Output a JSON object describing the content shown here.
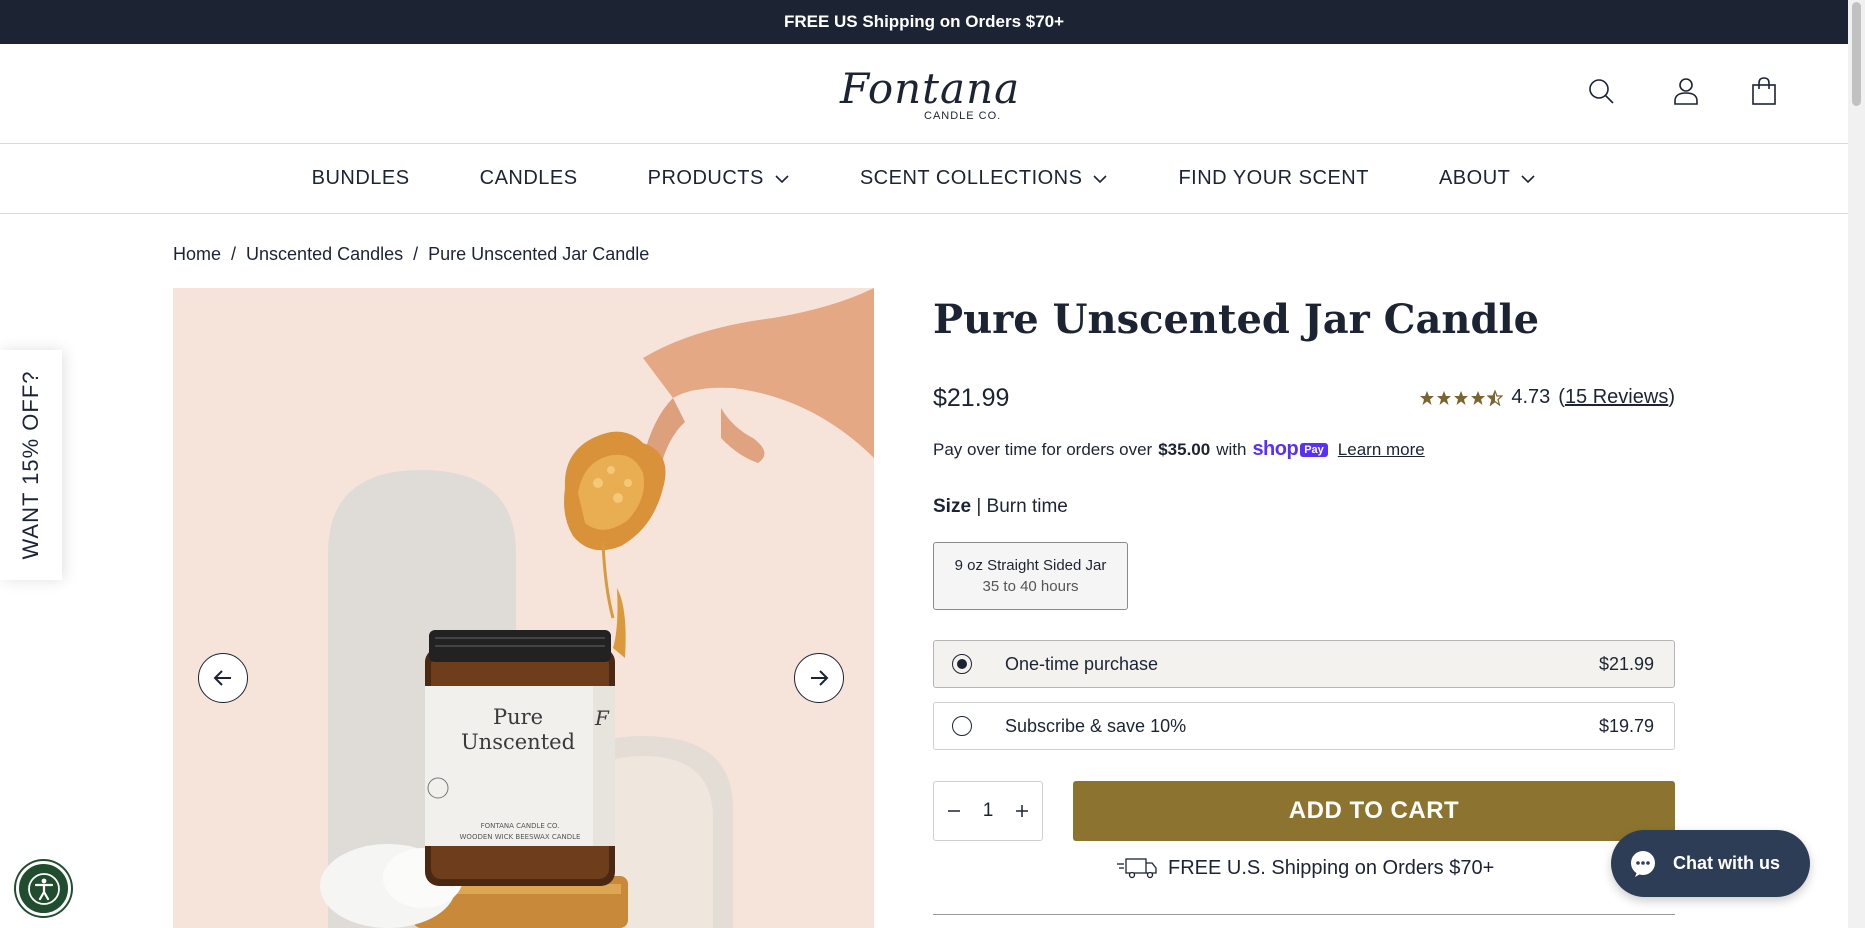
{
  "announcement": {
    "text": "FREE US Shipping on Orders $70+"
  },
  "header": {
    "logo": {
      "name": "Fontana",
      "tagline": "CANDLE CO."
    },
    "icons": [
      "search-icon",
      "account-icon",
      "cart-icon"
    ]
  },
  "nav": {
    "items": [
      {
        "label": "BUNDLES",
        "has_dropdown": false
      },
      {
        "label": "CANDLES",
        "has_dropdown": false
      },
      {
        "label": "PRODUCTS",
        "has_dropdown": true
      },
      {
        "label": "SCENT COLLECTIONS",
        "has_dropdown": true
      },
      {
        "label": "FIND YOUR SCENT",
        "has_dropdown": false
      },
      {
        "label": "ABOUT",
        "has_dropdown": true
      }
    ]
  },
  "breadcrumb": {
    "items": [
      "Home",
      "Unscented Candles",
      "Pure Unscented Jar Candle"
    ],
    "separator": "/"
  },
  "gallery": {
    "jar_label_line1": "Pure",
    "jar_label_line2": "Unscented",
    "jar_small_1": "FONTANA CANDLE CO.",
    "jar_small_2": "WOODEN WICK BEESWAX CANDLE",
    "jar_side_letter": "F"
  },
  "side_tab": {
    "label": "WANT 15% OFF?"
  },
  "product": {
    "title": "Pure Unscented Jar Candle",
    "price": "$21.99",
    "rating": {
      "stars": 4.5,
      "value": "4.73",
      "paren_open": "(",
      "reviews_label": "15 Reviews",
      "paren_close": ")"
    },
    "payover": {
      "prefix": "Pay over time for orders over",
      "amount": "$35.00",
      "suffix": "with",
      "shop": "shop",
      "pay": "Pay",
      "learn_more": "Learn more"
    },
    "size": {
      "label_bold": "Size",
      "label_rest": "| Burn time",
      "option_name": "9 oz Straight Sided Jar",
      "option_sub": "35 to 40 hours"
    },
    "plans": [
      {
        "label": "One-time purchase",
        "price": "$21.99",
        "selected": true
      },
      {
        "label": "Subscribe & save 10%",
        "price": "$19.79",
        "selected": false
      }
    ],
    "quantity": "1",
    "add_to_cart": "ADD TO CART",
    "shipping_note": "FREE U.S. Shipping on Orders $70+"
  },
  "chat": {
    "label": "Chat with us"
  },
  "colors": {
    "navy": "#1c2433",
    "gold_button": "#8c7430",
    "star": "#7a6530",
    "shop_pay": "#5a31f4",
    "chat_bg": "#2d3d55",
    "access_green": "#1f4d2e",
    "gallery_bg": "#f6e4da"
  }
}
